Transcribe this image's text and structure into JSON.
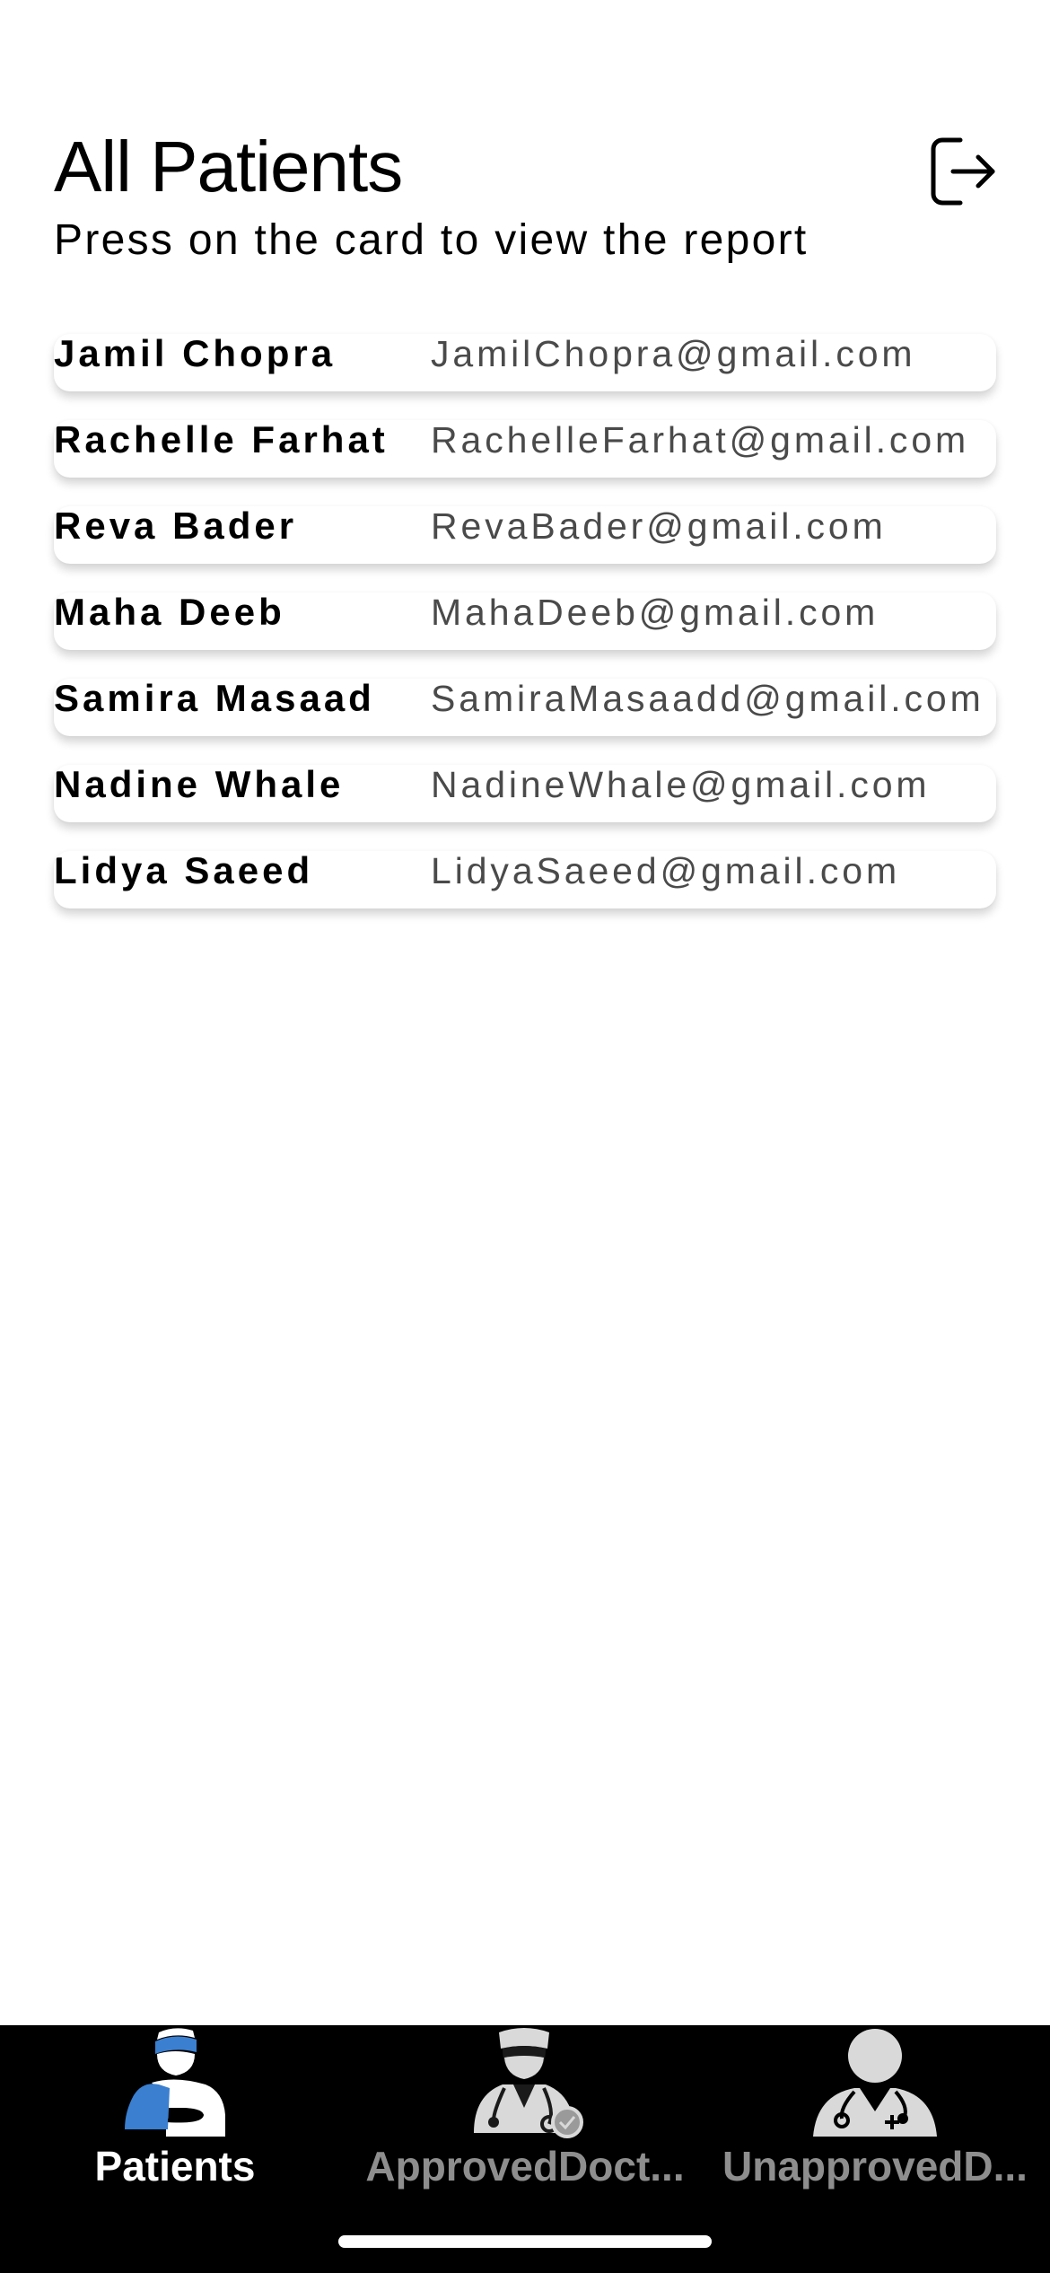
{
  "header": {
    "title": "All Patients",
    "subtitle": "Press on the card to view the report"
  },
  "patients": [
    {
      "name": "Jamil Chopra",
      "email": "JamilChopra@gmail.com"
    },
    {
      "name": "Rachelle Farhat",
      "email": "RachelleFarhat@gmail.com"
    },
    {
      "name": "Reva Bader",
      "email": "RevaBader@gmail.com"
    },
    {
      "name": "Maha Deeb",
      "email": "MahaDeeb@gmail.com"
    },
    {
      "name": "Samira Masaad",
      "email": "SamiraMasaadd@gmail.com"
    },
    {
      "name": "Nadine Whale",
      "email": "NadineWhale@gmail.com"
    },
    {
      "name": "Lidya Saeed",
      "email": "LidyaSaeed@gmail.com"
    }
  ],
  "tabbar": {
    "tabs": [
      {
        "label": "Patients",
        "icon": "patient-icon",
        "active": true
      },
      {
        "label": "ApprovedDoct...",
        "icon": "approved-doctor-icon",
        "active": false
      },
      {
        "label": "UnapprovedD...",
        "icon": "unapproved-doctor-icon",
        "active": false
      }
    ]
  },
  "colors": {
    "accent": "#3a7fd0",
    "tab_active": "#ffffff",
    "tab_inactive": "#8e8e8e",
    "email_text": "#4a4a4a"
  }
}
